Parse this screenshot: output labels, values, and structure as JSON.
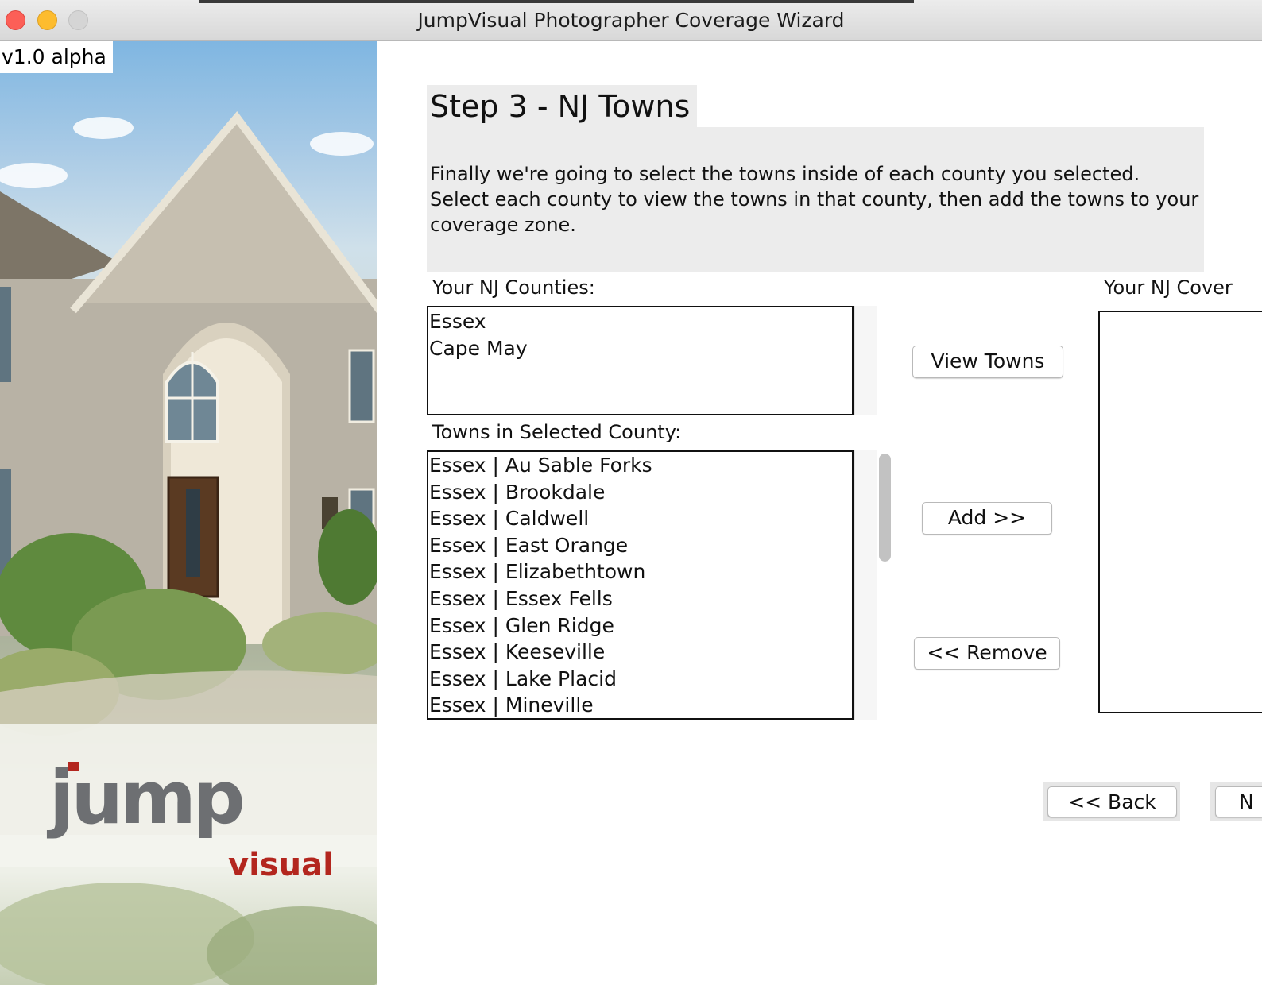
{
  "window": {
    "title": "JumpVisual Photographer Coverage Wizard"
  },
  "side_panel": {
    "version": "v1.0 alpha"
  },
  "step": {
    "heading": "Step 3 - NJ Towns",
    "description": "Finally we're going to select the towns inside of each county you selected. Select each county to view the towns in that county, then add the towns to your coverage zone."
  },
  "counties": {
    "label": "Your NJ Counties:",
    "items": [
      "Essex",
      "Cape May"
    ]
  },
  "towns": {
    "label": "Towns in Selected County:",
    "items": [
      "Essex | Au Sable Forks",
      "Essex | Brookdale",
      "Essex | Caldwell",
      "Essex | East Orange",
      "Essex | Elizabethtown",
      "Essex | Essex Fells",
      "Essex | Glen Ridge",
      "Essex | Keeseville",
      "Essex | Lake Placid",
      "Essex | Mineville"
    ]
  },
  "coverage": {
    "label": "Your NJ Cover",
    "items": []
  },
  "buttons": {
    "view_towns": "View Towns",
    "add": "Add >>",
    "remove": "<< Remove",
    "back": "<< Back",
    "next_partial": "N"
  },
  "colors": {
    "brand_red": "#b3261e",
    "brand_gray": "#6d6f72",
    "panel_gray": "#ececec"
  }
}
